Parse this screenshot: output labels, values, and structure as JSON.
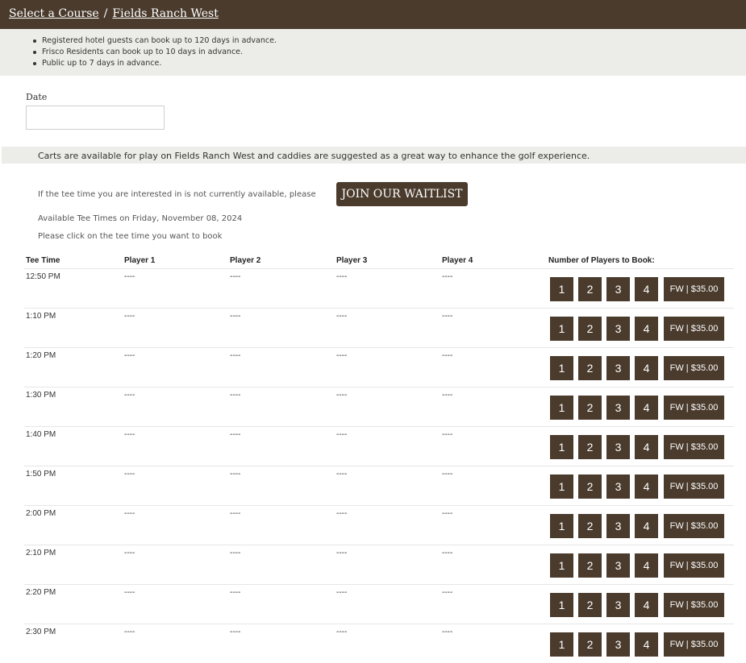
{
  "breadcrumb": {
    "select_course": "Select a Course",
    "separator": "/",
    "course_name": "Fields Ranch West"
  },
  "notes": [
    "Registered hotel guests can book up to 120 days in advance.",
    "Frisco Residents can book up to 10 days in advance.",
    "Public up to 7 days in advance."
  ],
  "date": {
    "label": "Date",
    "value": ""
  },
  "cart_banner": "Carts are available for play on Fields Ranch West and caddies are suggested as a great way to enhance the golf experience.",
  "waitlist": {
    "text": "If the tee time you are interested in is not currently available, please",
    "button": "JOIN OUR WAITLIST"
  },
  "available_text": "Available Tee Times on Friday, November 08, 2024",
  "instruction": "Please click on the tee time you want to book",
  "table": {
    "headers": [
      "Tee Time",
      "Player 1",
      "Player 2",
      "Player 3",
      "Player 4",
      "Number of Players to Book:"
    ],
    "player_options": [
      "1",
      "2",
      "3",
      "4"
    ],
    "rows": [
      {
        "time": "12:50 PM",
        "p1": "----",
        "p2": "----",
        "p3": "----",
        "p4": "----",
        "fee": "FW | $35.00"
      },
      {
        "time": "1:10 PM",
        "p1": "----",
        "p2": "----",
        "p3": "----",
        "p4": "----",
        "fee": "FW | $35.00"
      },
      {
        "time": "1:20 PM",
        "p1": "----",
        "p2": "----",
        "p3": "----",
        "p4": "----",
        "fee": "FW | $35.00"
      },
      {
        "time": "1:30 PM",
        "p1": "----",
        "p2": "----",
        "p3": "----",
        "p4": "----",
        "fee": "FW | $35.00"
      },
      {
        "time": "1:40 PM",
        "p1": "----",
        "p2": "----",
        "p3": "----",
        "p4": "----",
        "fee": "FW | $35.00"
      },
      {
        "time": "1:50 PM",
        "p1": "----",
        "p2": "----",
        "p3": "----",
        "p4": "----",
        "fee": "FW | $35.00"
      },
      {
        "time": "2:00 PM",
        "p1": "----",
        "p2": "----",
        "p3": "----",
        "p4": "----",
        "fee": "FW | $35.00"
      },
      {
        "time": "2:10 PM",
        "p1": "----",
        "p2": "----",
        "p3": "----",
        "p4": "----",
        "fee": "FW | $35.00"
      },
      {
        "time": "2:20 PM",
        "p1": "----",
        "p2": "----",
        "p3": "----",
        "p4": "----",
        "fee": "FW | $35.00"
      },
      {
        "time": "2:30 PM",
        "p1": "----",
        "p2": "----",
        "p3": "----",
        "p4": "----",
        "fee": "FW | $35.00"
      }
    ]
  },
  "colors": {
    "brand": "#4a3b2d",
    "banner_bg": "#ecece8"
  }
}
